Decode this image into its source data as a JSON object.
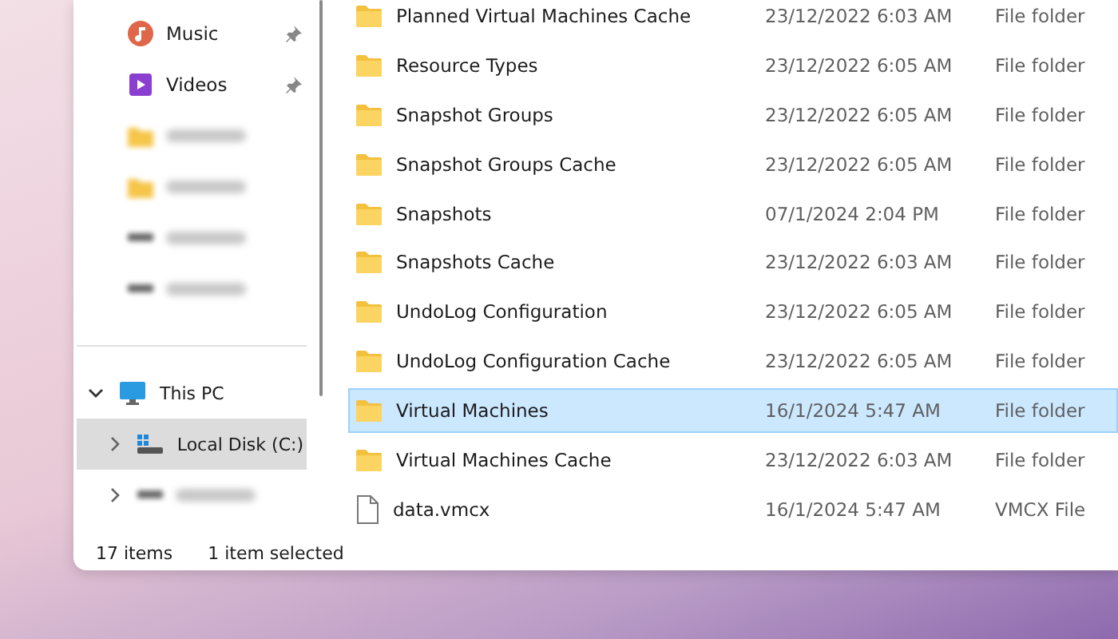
{
  "sidebar": {
    "quick_access": [
      {
        "kind": "music",
        "label": "Music",
        "pinned": true
      },
      {
        "kind": "videos",
        "label": "Videos",
        "pinned": true
      },
      {
        "kind": "blurredfolder",
        "pinned": false
      },
      {
        "kind": "blurredfolder",
        "pinned": false
      },
      {
        "kind": "blurreddrive",
        "pinned": false
      },
      {
        "kind": "blurreddrive",
        "pinned": false
      }
    ],
    "tree": [
      {
        "kind": "pc",
        "label": "This PC",
        "expanded": true,
        "selected": false,
        "children": [
          {
            "kind": "systemdrive",
            "label": "Local Disk (C:)",
            "expanded": false,
            "selected": true
          },
          {
            "kind": "blurreddrive",
            "expanded": false,
            "selected": false
          }
        ]
      }
    ]
  },
  "files": [
    {
      "kind": "folder",
      "name": "Planned Virtual Machines Cache",
      "date": "23/12/2022 6:03 AM",
      "type": "File folder",
      "selected": false
    },
    {
      "kind": "folder",
      "name": "Resource Types",
      "date": "23/12/2022 6:05 AM",
      "type": "File folder",
      "selected": false
    },
    {
      "kind": "folder",
      "name": "Snapshot Groups",
      "date": "23/12/2022 6:05 AM",
      "type": "File folder",
      "selected": false
    },
    {
      "kind": "folder",
      "name": "Snapshot Groups Cache",
      "date": "23/12/2022 6:05 AM",
      "type": "File folder",
      "selected": false
    },
    {
      "kind": "folder",
      "name": "Snapshots",
      "date": "07/1/2024 2:04 PM",
      "type": "File folder",
      "selected": false
    },
    {
      "kind": "folder",
      "name": "Snapshots Cache",
      "date": "23/12/2022 6:03 AM",
      "type": "File folder",
      "selected": false
    },
    {
      "kind": "folder",
      "name": "UndoLog Configuration",
      "date": "23/12/2022 6:05 AM",
      "type": "File folder",
      "selected": false
    },
    {
      "kind": "folder",
      "name": "UndoLog Configuration Cache",
      "date": "23/12/2022 6:05 AM",
      "type": "File folder",
      "selected": false
    },
    {
      "kind": "folder",
      "name": "Virtual Machines",
      "date": "16/1/2024 5:47 AM",
      "type": "File folder",
      "selected": true
    },
    {
      "kind": "folder",
      "name": "Virtual Machines Cache",
      "date": "23/12/2022 6:03 AM",
      "type": "File folder",
      "selected": false
    },
    {
      "kind": "file",
      "name": "data.vmcx",
      "date": "16/1/2024 5:47 AM",
      "type": "VMCX File",
      "selected": false
    }
  ],
  "status_bar": {
    "item_count": "17 items",
    "selection": "1 item selected"
  }
}
